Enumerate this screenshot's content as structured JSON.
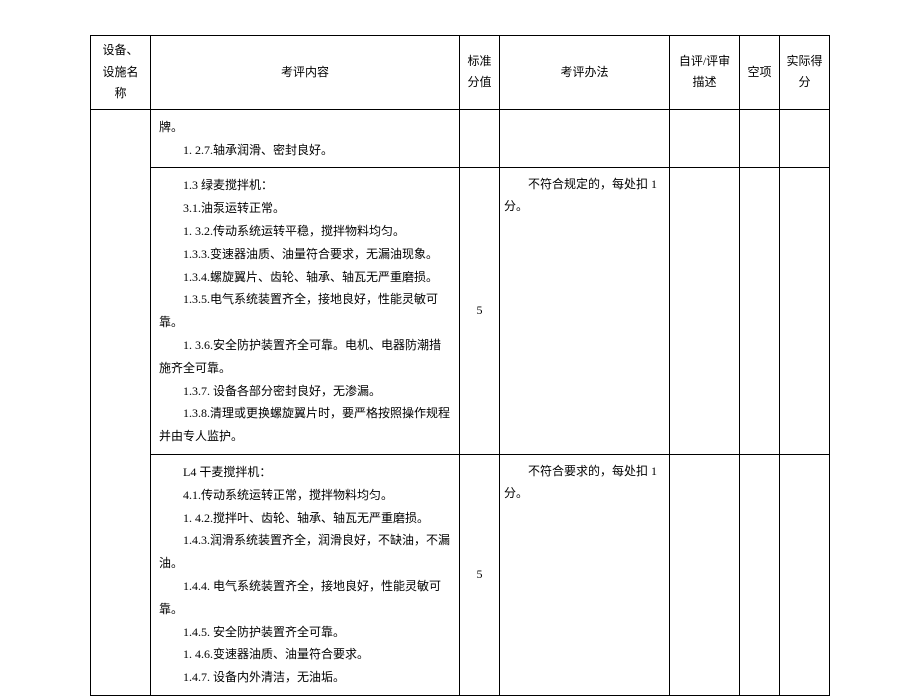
{
  "headers": {
    "col1": "设备、设施名称",
    "col2": "考评内容",
    "col3": "标准分值",
    "col4": "考评办法",
    "col5": "自评/评审描述",
    "col6": "空项",
    "col7": "实际得分"
  },
  "rows": [
    {
      "content_lines": [
        "牌。",
        "1. 2.7.轴承润滑、密封良好。"
      ],
      "std": "",
      "method": ""
    },
    {
      "content_lines": [
        "1.3 绿麦搅拌机：",
        "3.1.油泵运转正常。",
        "1. 3.2.传动系统运转平稳，搅拌物料均匀。",
        "1.3.3.变速器油质、油量符合要求，无漏油现象。",
        "1.3.4.螺旋翼片、齿轮、轴承、轴瓦无严重磨损。",
        "1.3.5.电气系统装置齐全，接地良好，性能灵敏可靠。",
        "1. 3.6.安全防护装置齐全可靠。电机、电器防潮措施齐全可靠。",
        "1.3.7. 设备各部分密封良好，无渗漏。",
        "1.3.8.清理或更换螺旋翼片时，要严格按照操作规程并由专人监护。"
      ],
      "std": "5",
      "method": "不符合规定的，每处扣 1 分。"
    },
    {
      "content_lines": [
        "L4 干麦搅拌机：",
        "4.1.传动系统运转正常，搅拌物料均匀。",
        "1. 4.2.搅拌叶、齿轮、轴承、轴瓦无严重磨损。",
        "1.4.3.润滑系统装置齐全，润滑良好，不缺油，不漏油。",
        "1.4.4. 电气系统装置齐全，接地良好，性能灵敏可靠。",
        "1.4.5. 安全防护装置齐全可靠。",
        "1. 4.6.变速器油质、油量符合要求。",
        "1.4.7. 设备内外清洁，无油垢。"
      ],
      "std": "5",
      "method": "不符合要求的，每处扣 1 分。"
    }
  ]
}
